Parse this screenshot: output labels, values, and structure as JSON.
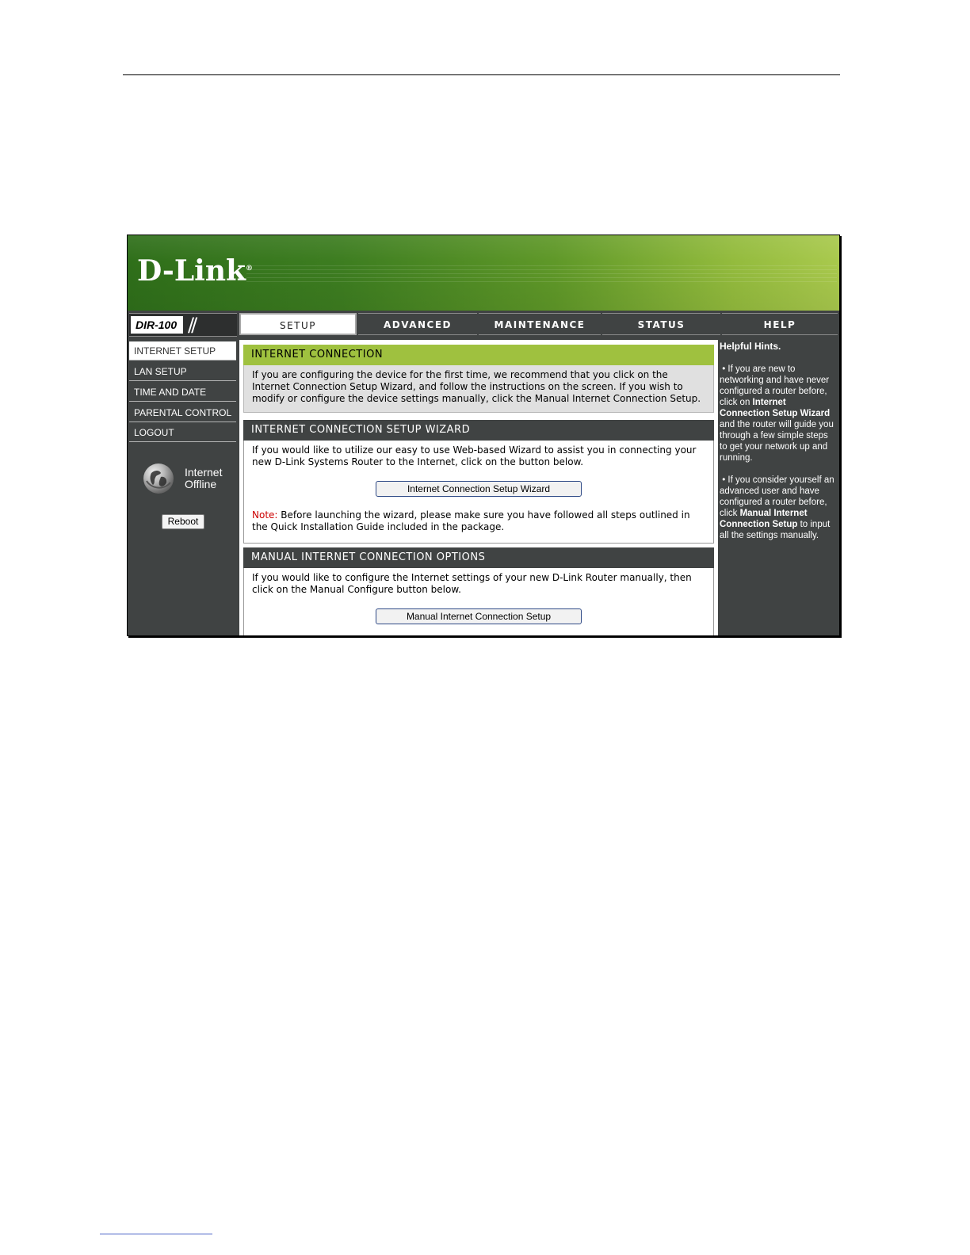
{
  "brand": {
    "logo_text": "D-Link",
    "logo_mark": "®",
    "model": "DIR-100"
  },
  "tabs": [
    {
      "label": "SETUP",
      "active": true
    },
    {
      "label": "ADVANCED",
      "active": false
    },
    {
      "label": "MAINTENANCE",
      "active": false
    },
    {
      "label": "STATUS",
      "active": false
    },
    {
      "label": "HELP",
      "active": false
    }
  ],
  "sidebar": {
    "items": [
      {
        "label": "INTERNET SETUP",
        "active": true
      },
      {
        "label": "LAN SETUP",
        "active": false
      },
      {
        "label": "TIME AND DATE",
        "active": false
      },
      {
        "label": "PARENTAL CONTROL",
        "active": false
      },
      {
        "label": "LOGOUT",
        "active": false
      }
    ],
    "status_line1": "Internet",
    "status_line2": "Offline",
    "reboot_label": "Reboot",
    "status_icon": "globe-icon"
  },
  "main": {
    "internet_connection": {
      "title": "INTERNET CONNECTION",
      "body": "If you are configuring the device for the first time, we recommend that you click on the Internet Connection Setup Wizard, and follow the instructions on the screen. If you wish to modify or configure the device settings manually, click the Manual Internet Connection Setup."
    },
    "wizard": {
      "title": "INTERNET CONNECTION SETUP WIZARD",
      "body": "If you would like to utilize our easy to use Web-based Wizard to assist you in connecting your new D-Link Systems Router to the Internet, click on the button below.",
      "button_label": "Internet Connection Setup Wizard",
      "note_label": "Note:",
      "note_text": " Before launching the wizard, please make sure you have followed all steps outlined in the Quick Installation Guide included in the package."
    },
    "manual": {
      "title": "MANUAL INTERNET CONNECTION OPTIONS",
      "body": "If you would like to configure the Internet settings of your new D-Link Router manually, then click on the Manual Configure button below.",
      "button_label": "Manual Internet Connection Setup"
    }
  },
  "help": {
    "title": "Helpful Hints.",
    "hint1": {
      "bullet": "•",
      "pre": " If you are new to networking and have never configured a router before, click on ",
      "bold": "Internet Connection Setup Wizard",
      "post": " and the router will guide you through a few simple steps to get your network up and running."
    },
    "hint2": {
      "bullet": "•",
      "pre": " If you consider yourself an advanced user and have configured a router before, click ",
      "bold": "Manual Internet Connection Setup",
      "post": " to input all the settings manually."
    }
  },
  "colors": {
    "accent_green": "#9fc13f",
    "panel_dark": "#404343",
    "note_red": "#cc0000"
  }
}
